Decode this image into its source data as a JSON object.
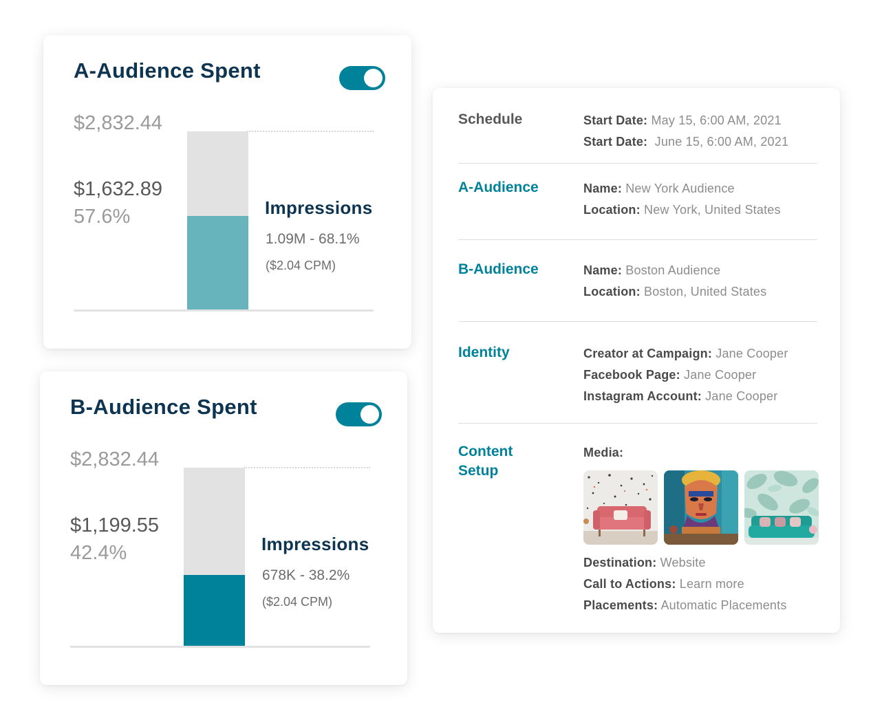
{
  "audience_a": {
    "title": "A-Audience Spent",
    "toggle_on": true,
    "total": "$2,832.44",
    "spent": "$1,632.89",
    "spent_percent": "57.6%",
    "impressions_label": "Impressions",
    "impressions": "1.09M - 68.1%",
    "cpm": "($2.04 CPM)",
    "spent_fraction": 0.529,
    "bar_color": "#68b4bc"
  },
  "audience_b": {
    "title": "B-Audience Spent",
    "toggle_on": true,
    "total": "$2,832.44",
    "spent": "$1,199.55",
    "spent_percent": "42.4%",
    "impressions_label": "Impressions",
    "impressions": "678K - 38.2%",
    "cpm": "($2.04 CPM)",
    "spent_fraction": 0.405,
    "bar_color": "#00829a"
  },
  "details": {
    "schedule": {
      "label": "Schedule",
      "start_label": "Start Date:",
      "start_value": "May 15, 6:00 AM, 2021",
      "end_label": "Start Date:",
      "end_value": " June 15, 6:00 AM, 2021"
    },
    "a_audience": {
      "label": "A-Audience",
      "name_label": "Name:",
      "name_value": "New York Audience",
      "location_label": "Location:",
      "location_value": "New York, United States"
    },
    "b_audience": {
      "label": "B-Audience",
      "name_label": "Name:",
      "name_value": "Boston Audience",
      "location_label": "Location:",
      "location_value": "Boston, United States"
    },
    "identity": {
      "label": "Identity",
      "creator_label": "Creator at Campaign:",
      "creator_value": "Jane Cooper",
      "facebook_label": "Facebook Page:",
      "facebook_value": "Jane Cooper",
      "instagram_label": "Instagram Account:",
      "instagram_value": "Jane Cooper"
    },
    "content": {
      "label_line1": "Content",
      "label_line2": "Setup",
      "media_label": "Media:",
      "destination_label": "Destination:",
      "destination_value": "Website",
      "cta_label": "Call to Actions:",
      "cta_value": "Learn more",
      "placements_label": "Placements:",
      "placements_value": "Automatic Placements"
    }
  },
  "colors": {
    "title": "#0d3450",
    "teal": "#00829a",
    "teal_light": "#68b4bc",
    "section_gray": "#585858"
  }
}
